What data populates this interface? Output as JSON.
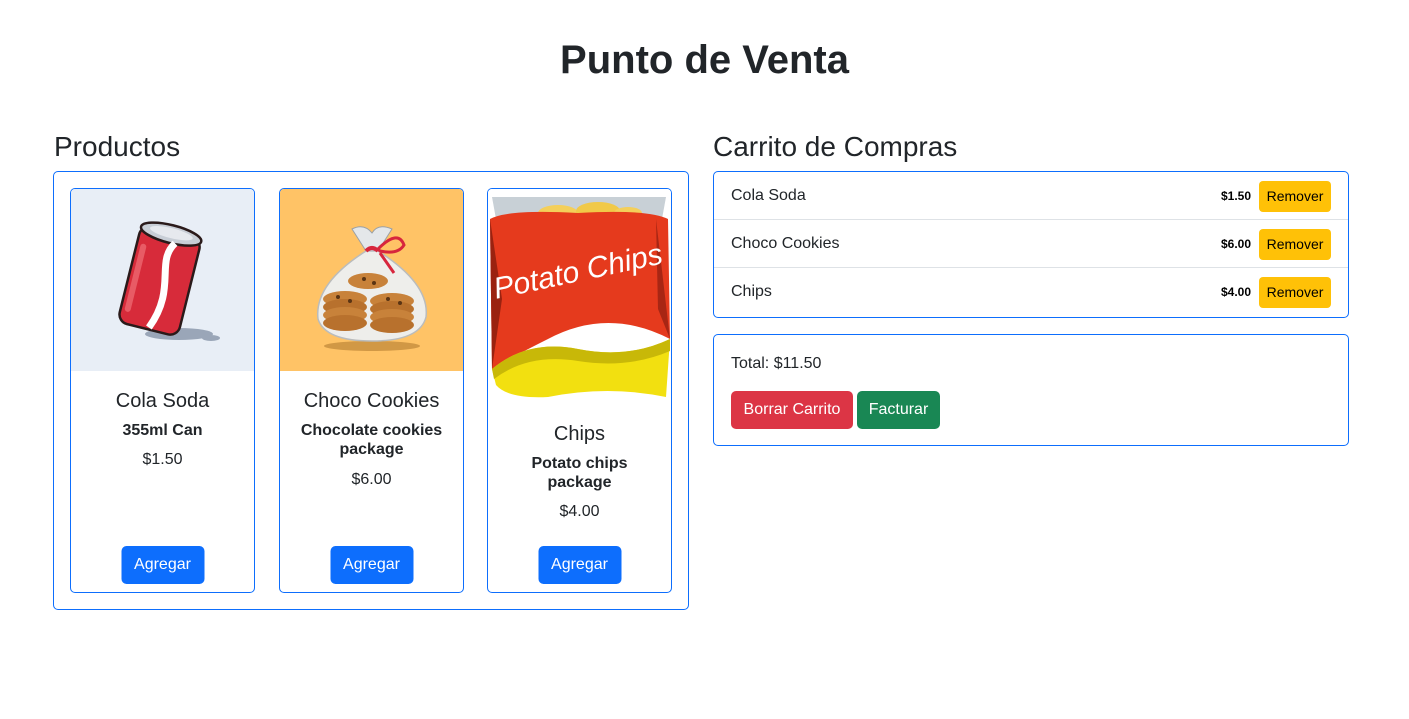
{
  "page": {
    "title": "Punto de Venta"
  },
  "products_section": {
    "title": "Productos",
    "items": [
      {
        "name": "Cola Soda",
        "description": "355ml Can",
        "price": "$1.50",
        "button_label": "Agregar",
        "image_icon": "soda-can-icon",
        "image_bg": "#e8eef6"
      },
      {
        "name": "Choco Cookies",
        "description": "Chocolate cookies package",
        "price": "$6.00",
        "button_label": "Agregar",
        "image_icon": "cookies-bag-icon",
        "image_bg": "#ffc366"
      },
      {
        "name": "Chips",
        "description": "Potato chips package",
        "price": "$4.00",
        "button_label": "Agregar",
        "image_icon": "potato-chips-bag-icon",
        "image_bg": "#ffffff",
        "image_text": "Potato Chips"
      }
    ]
  },
  "cart_section": {
    "title": "Carrito de Compras",
    "items": [
      {
        "name": "Cola Soda",
        "price": "$1.50",
        "button_label": "Remover"
      },
      {
        "name": "Choco Cookies",
        "price": "$6.00",
        "button_label": "Remover"
      },
      {
        "name": "Chips",
        "price": "$4.00",
        "button_label": "Remover"
      }
    ],
    "total_text": "Total: $11.50",
    "clear_button_label": "Borrar Carrito",
    "invoice_button_label": "Facturar"
  },
  "colors": {
    "primary": "#0d6efd",
    "warning": "#ffc107",
    "danger": "#dc3545",
    "success": "#198754",
    "text": "#212529"
  }
}
